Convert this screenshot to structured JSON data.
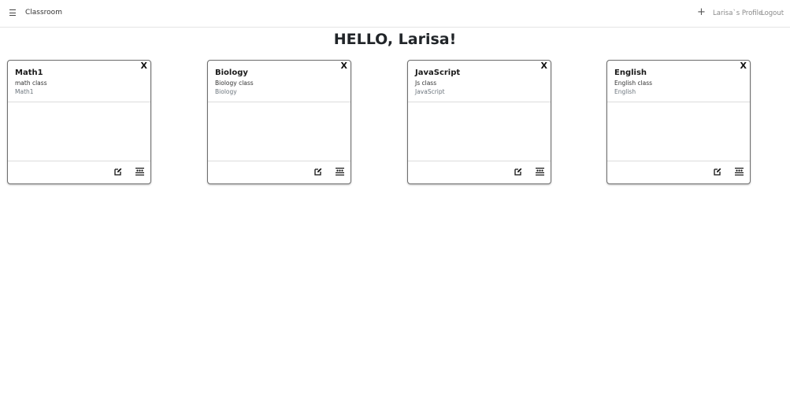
{
  "navbar": {
    "menu_icon": "hamburger-icon",
    "brand": "Classroom",
    "add_icon": "plus-icon",
    "profile_link": "Larisa`s Profile",
    "logout_link": "Logout"
  },
  "greeting": "HELLO, Larisa!",
  "cards": [
    {
      "title": "Math1",
      "description": "math class",
      "subject": "Math1",
      "close_label": "X"
    },
    {
      "title": "Biology",
      "description": "Biology class",
      "subject": "Biology",
      "close_label": "X"
    },
    {
      "title": "JavaScript",
      "description": "Js class",
      "subject": "JavaScript",
      "close_label": "X"
    },
    {
      "title": "English",
      "description": "English class",
      "subject": "English",
      "close_label": "X"
    }
  ],
  "card_icons": {
    "edit": "edit-icon",
    "students": "people-icon"
  }
}
